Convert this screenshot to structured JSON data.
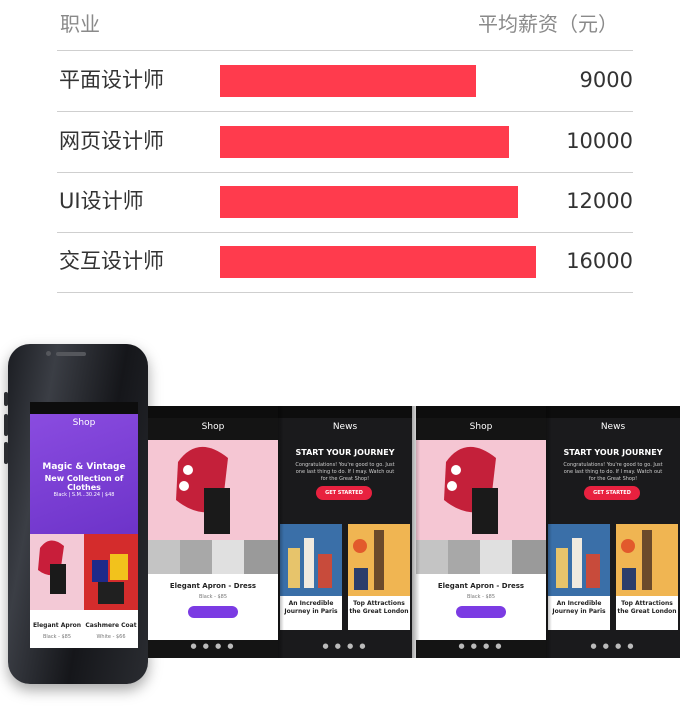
{
  "header": {
    "role_label": "职业",
    "salary_label": "平均薪资（元）"
  },
  "chart_data": {
    "type": "bar",
    "categories": [
      "平面设计师",
      "网页设计师",
      "UI设计师",
      "交互设计师"
    ],
    "values": [
      9000,
      10000,
      12000,
      16000
    ],
    "value_labels": [
      "9000",
      "10000",
      "12000",
      "16000"
    ],
    "bar_color": "#ff3b4d",
    "xlabel": "职业",
    "ylabel": "平均薪资（元）"
  },
  "mockup": {
    "shop_title": "Shop",
    "news_title": "News",
    "hero_heading_line1": "Magic & Vintage",
    "hero_heading_line2": "New Collection of Clothes",
    "hero_sub": "Black | S.M...30.24 | $48",
    "product1_name": "Elegant Apron",
    "product1_price": "Black - $85",
    "product2_name": "Cashmere Coat",
    "product2_price": "White - $66",
    "product_dress_name": "Elegant Apron - Dress",
    "product_dress_price": "Black - $85",
    "journey_title": "START YOUR JOURNEY",
    "journey_body": "Congratulations! You're good to go. Just one last thing to do. If I may. Watch out for the Great Shop!",
    "get_started": "GET STARTED",
    "card1_title_line1": "An Incredible",
    "card1_title_line2": "Journey in Paris",
    "card2_title_line1": "Top Attractions",
    "card2_title_line2": "the Great London",
    "colors": {
      "purple": "#7b3be3",
      "red": "#e8213f",
      "dark": "#141414"
    }
  }
}
